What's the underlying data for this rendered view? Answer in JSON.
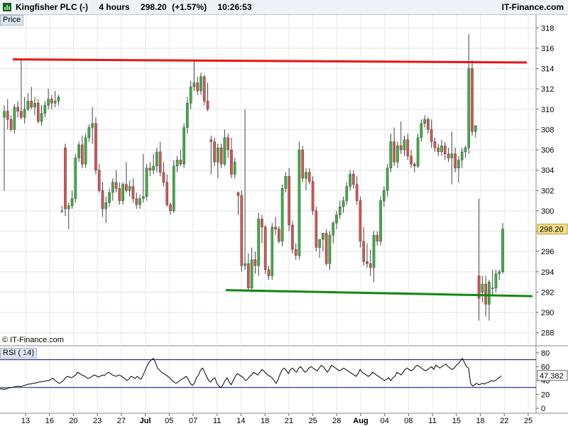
{
  "header": {
    "symbol": "Kingfisher PLC (-)",
    "interval": "4 hours",
    "price": "298.20",
    "change": "(+1.57%)",
    "time": "10:26:53",
    "site": "IT-Finance.com"
  },
  "price_panel_label": "Price",
  "rsi_panel_label": "RSI ( 14)",
  "copyright": "© IT-Finance.com",
  "colors": {
    "up": "#3cb043",
    "down": "#d9534f",
    "resistance": "#ee1111",
    "support": "#118811",
    "rsi": "#000000",
    "rsi_levels": "#000088"
  },
  "chart_data": [
    {
      "type": "candlestick",
      "title": "Price",
      "ylim": [
        287,
        319
      ],
      "y_ticks": [
        "318",
        "316",
        "314",
        "312",
        "310",
        "308",
        "306",
        "304",
        "302",
        "300",
        "298",
        "296",
        "294",
        "292",
        "290",
        "288"
      ],
      "last_price_label": "298.20",
      "x_ticks": [
        "13",
        "16",
        "20",
        "23",
        "27",
        "Jul",
        "05",
        "07",
        "11",
        "14",
        "18",
        "21",
        "25",
        "28",
        "Aug",
        "04",
        "08",
        "11",
        "15",
        "18",
        "22",
        "25"
      ],
      "candles": [
        [
          309.2,
          310.4,
          302.0,
          309.8
        ],
        [
          309.8,
          311.0,
          308.0,
          309.0
        ],
        [
          309.0,
          309.4,
          307.8,
          308.0
        ],
        [
          308.0,
          310.5,
          307.6,
          310.2
        ],
        [
          310.2,
          310.8,
          309.2,
          309.8
        ],
        [
          309.8,
          314.8,
          309.0,
          309.2
        ],
        [
          309.2,
          311.2,
          308.6,
          310.0
        ],
        [
          310.0,
          311.6,
          309.8,
          310.8
        ],
        [
          310.8,
          312.2,
          310.0,
          310.2
        ],
        [
          310.2,
          311.2,
          309.4,
          310.6
        ],
        [
          310.6,
          311.0,
          308.6,
          308.8
        ],
        [
          308.8,
          310.4,
          308.4,
          309.6
        ],
        [
          309.6,
          310.8,
          309.2,
          310.4
        ],
        [
          310.4,
          312.0,
          310.0,
          311.0
        ],
        [
          311.0,
          311.4,
          310.0,
          310.6
        ],
        [
          310.6,
          311.8,
          310.2,
          310.8
        ],
        [
          310.8,
          311.4,
          310.4,
          311.2
        ],
        [
          300.0,
          300.5,
          299.8,
          300.0
        ],
        [
          306.2,
          306.6,
          299.5,
          300.2
        ],
        [
          300.2,
          300.8,
          298.2,
          300.5
        ],
        [
          300.5,
          302.0,
          300.2,
          301.2
        ],
        [
          301.2,
          305.6,
          300.8,
          305.2
        ],
        [
          305.2,
          306.8,
          304.8,
          306.5
        ],
        [
          306.5,
          307.4,
          304.2,
          304.6
        ],
        [
          304.6,
          307.6,
          304.2,
          307.2
        ],
        [
          307.2,
          308.5,
          306.8,
          308.2
        ],
        [
          308.2,
          310.2,
          306.6,
          308.6
        ],
        [
          308.6,
          309.2,
          303.6,
          304.0
        ],
        [
          304.0,
          304.6,
          301.8,
          302.0
        ],
        [
          302.0,
          302.8,
          299.4,
          300.2
        ],
        [
          300.2,
          301.4,
          298.8,
          300.8
        ],
        [
          300.8,
          302.2,
          300.4,
          301.8
        ],
        [
          301.8,
          303.2,
          301.0,
          302.8
        ],
        [
          302.8,
          304.0,
          301.8,
          302.2
        ],
        [
          302.2,
          302.8,
          300.6,
          301.0
        ],
        [
          301.0,
          302.8,
          300.6,
          302.6
        ],
        [
          302.6,
          304.8,
          301.8,
          302.0
        ],
        [
          302.0,
          303.0,
          301.4,
          302.4
        ],
        [
          302.4,
          303.2,
          300.8,
          301.2
        ],
        [
          301.2,
          301.8,
          300.2,
          300.6
        ],
        [
          300.6,
          301.6,
          300.2,
          301.2
        ],
        [
          301.2,
          305.6,
          300.8,
          301.4
        ],
        [
          301.4,
          304.6,
          301.0,
          304.2
        ],
        [
          304.2,
          304.8,
          303.4,
          304.0
        ],
        [
          304.0,
          305.6,
          303.6,
          304.4
        ],
        [
          304.4,
          306.2,
          303.8,
          305.8
        ],
        [
          305.8,
          306.8,
          303.4,
          303.8
        ],
        [
          303.8,
          304.8,
          302.4,
          302.8
        ],
        [
          302.8,
          303.6,
          300.4,
          300.6
        ],
        [
          300.6,
          300.8,
          299.6,
          300.0
        ],
        [
          300.0,
          305.0,
          299.8,
          304.4
        ],
        [
          304.4,
          305.4,
          303.8,
          305.0
        ],
        [
          305.0,
          306.0,
          304.4,
          304.6
        ],
        [
          304.6,
          308.6,
          304.2,
          308.2
        ],
        [
          308.2,
          311.2,
          307.6,
          310.6
        ],
        [
          310.6,
          312.8,
          310.0,
          312.2
        ],
        [
          312.2,
          314.8,
          311.8,
          312.6
        ],
        [
          312.6,
          313.2,
          311.4,
          311.8
        ],
        [
          311.8,
          313.6,
          311.4,
          313.2
        ],
        [
          313.2,
          313.4,
          310.4,
          310.8
        ],
        [
          310.8,
          312.6,
          309.8,
          310.0
        ],
        [
          307.0,
          307.4,
          303.6,
          306.8
        ],
        [
          306.8,
          307.2,
          304.4,
          304.8
        ],
        [
          304.8,
          306.6,
          303.2,
          306.2
        ],
        [
          306.2,
          306.6,
          304.2,
          304.6
        ],
        [
          304.6,
          308.0,
          304.4,
          307.2
        ],
        [
          307.2,
          307.6,
          305.2,
          306.0
        ],
        [
          306.0,
          307.2,
          303.2,
          303.6
        ],
        [
          303.6,
          305.2,
          303.2,
          304.8
        ],
        [
          301.8,
          301.9,
          299.6,
          301.5
        ],
        [
          301.5,
          302.0,
          294.0,
          294.6
        ],
        [
          294.6,
          310.0,
          294.2,
          294.8
        ],
        [
          294.8,
          295.8,
          292.2,
          292.4
        ],
        [
          292.4,
          296.4,
          292.0,
          295.2
        ],
        [
          295.2,
          296.0,
          293.8,
          294.6
        ],
        [
          294.6,
          299.8,
          293.6,
          299.2
        ],
        [
          299.2,
          299.6,
          296.8,
          298.4
        ],
        [
          298.4,
          298.6,
          293.8,
          294.2
        ],
        [
          294.2,
          294.6,
          293.2,
          293.6
        ],
        [
          293.6,
          298.8,
          293.2,
          298.4
        ],
        [
          298.4,
          299.4,
          297.6,
          298.2
        ],
        [
          298.2,
          298.5,
          296.8,
          297.0
        ],
        [
          297.0,
          302.6,
          296.5,
          302.2
        ],
        [
          302.2,
          303.8,
          301.8,
          303.4
        ],
        [
          303.4,
          304.2,
          298.0,
          298.6
        ],
        [
          298.6,
          299.0,
          295.8,
          296.2
        ],
        [
          296.2,
          296.8,
          295.2,
          295.6
        ],
        [
          295.6,
          306.8,
          295.2,
          306.0
        ],
        [
          306.0,
          306.4,
          302.8,
          303.2
        ],
        [
          303.2,
          304.2,
          302.0,
          303.8
        ],
        [
          303.8,
          304.2,
          302.6,
          302.9
        ],
        [
          302.9,
          303.4,
          299.6,
          300.0
        ],
        [
          300.0,
          300.4,
          296.0,
          296.4
        ],
        [
          296.4,
          296.8,
          295.4,
          297.2
        ],
        [
          297.2,
          297.6,
          296.0,
          297.8
        ],
        [
          297.8,
          298.2,
          294.6,
          294.8
        ],
        [
          294.8,
          298.0,
          294.2,
          297.6
        ],
        [
          297.6,
          299.0,
          296.8,
          298.8
        ],
        [
          298.8,
          300.0,
          298.2,
          299.6
        ],
        [
          299.6,
          301.0,
          299.2,
          300.4
        ],
        [
          300.4,
          301.4,
          299.8,
          301.0
        ],
        [
          301.0,
          302.8,
          300.6,
          302.4
        ],
        [
          302.4,
          304.0,
          302.0,
          303.6
        ],
        [
          303.6,
          304.0,
          302.2,
          302.6
        ],
        [
          302.6,
          303.4,
          300.6,
          301.0
        ],
        [
          301.0,
          301.4,
          296.4,
          297.0
        ],
        [
          297.0,
          298.4,
          294.6,
          295.0
        ],
        [
          295.0,
          296.8,
          294.4,
          294.8
        ],
        [
          294.8,
          296.2,
          293.6,
          294.4
        ],
        [
          294.4,
          298.0,
          293.0,
          297.6
        ],
        [
          297.6,
          298.0,
          296.6,
          297.0
        ],
        [
          297.0,
          301.4,
          296.6,
          301.0
        ],
        [
          301.0,
          302.4,
          300.4,
          302.0
        ],
        [
          302.0,
          304.6,
          301.4,
          304.2
        ],
        [
          304.2,
          307.6,
          303.8,
          306.8
        ],
        [
          306.8,
          308.2,
          304.4,
          304.8
        ],
        [
          304.8,
          306.8,
          304.2,
          306.4
        ],
        [
          306.4,
          308.8,
          305.6,
          306.0
        ],
        [
          306.0,
          307.4,
          305.4,
          307.0
        ],
        [
          307.0,
          307.6,
          305.0,
          305.4
        ],
        [
          305.4,
          306.0,
          304.2,
          304.6
        ],
        [
          304.6,
          304.8,
          303.8,
          304.4
        ],
        [
          304.4,
          307.6,
          304.2,
          307.2
        ],
        [
          307.2,
          309.0,
          306.8,
          308.6
        ],
        [
          308.6,
          309.4,
          308.2,
          309.0
        ],
        [
          309.0,
          309.2,
          307.6,
          308.0
        ],
        [
          308.0,
          309.0,
          306.2,
          306.8
        ],
        [
          306.8,
          307.2,
          305.8,
          306.2
        ],
        [
          306.2,
          306.6,
          305.4,
          305.8
        ],
        [
          305.8,
          307.0,
          305.4,
          306.4
        ],
        [
          306.4,
          306.8,
          305.0,
          305.6
        ],
        [
          305.6,
          306.2,
          304.8,
          305.2
        ],
        [
          305.2,
          307.8,
          302.6,
          305.6
        ],
        [
          305.6,
          306.2,
          303.8,
          304.2
        ],
        [
          304.2,
          305.4,
          302.8,
          305.0
        ],
        [
          305.0,
          306.2,
          304.2,
          305.8
        ],
        [
          305.8,
          306.4,
          305.2,
          306.2
        ],
        [
          306.2,
          317.4,
          305.6,
          314.0
        ],
        [
          314.0,
          314.8,
          307.4,
          307.8
        ],
        [
          307.8,
          308.2,
          307.2,
          308.4
        ],
        [
          293.6,
          301.2,
          289.2,
          291.4
        ],
        [
          292.0,
          293.6,
          291.0,
          292.8
        ],
        [
          292.8,
          293.6,
          289.6,
          290.8
        ],
        [
          290.8,
          293.2,
          289.2,
          293.0
        ],
        [
          292.4,
          294.2,
          291.6,
          292.4
        ],
        [
          292.4,
          294.2,
          292.0,
          293.8
        ],
        [
          293.8,
          294.2,
          293.2,
          294.0
        ],
        [
          294.0,
          298.8,
          293.8,
          298.2
        ]
      ],
      "resistance": {
        "from": [
          316.0,
          314.9
        ],
        "to": [
          316.4,
          314.6
        ]
      },
      "support": {
        "from": [
          292.0,
          292.2
        ],
        "to": [
          292.4,
          291.6
        ]
      }
    },
    {
      "type": "line",
      "title": "RSI ( 14)",
      "ylim": [
        -5,
        85
      ],
      "y_ticks": [
        "80",
        "60",
        "40",
        "20",
        "0"
      ],
      "levels": [
        70,
        30
      ],
      "last_value_label": "47.382",
      "values": [
        28,
        28,
        27,
        28,
        29,
        30,
        30,
        31,
        31,
        32,
        31,
        32,
        33,
        34,
        35,
        35,
        36,
        36,
        37,
        38,
        38,
        39,
        39,
        40,
        40,
        42,
        43,
        40,
        38,
        36,
        38,
        40,
        44,
        46,
        45,
        44,
        46,
        48,
        52,
        50,
        48,
        47,
        45,
        43,
        44,
        46,
        48,
        47,
        45,
        46,
        48,
        47,
        50,
        52,
        50,
        48,
        47,
        46,
        48,
        47,
        45,
        43,
        40,
        42,
        46,
        45,
        43,
        46,
        44,
        42,
        48,
        55,
        62,
        67,
        70,
        72,
        66,
        58,
        55,
        52,
        50,
        48,
        46,
        44,
        40,
        38,
        36,
        38,
        40,
        42,
        44,
        46,
        42,
        36,
        33,
        36,
        44,
        48,
        55,
        58,
        52,
        46,
        40,
        38,
        42,
        44,
        36,
        32,
        30,
        34,
        40,
        44,
        38,
        34,
        40,
        46,
        50,
        48,
        46,
        44,
        40,
        42,
        46,
        48,
        52,
        50,
        48,
        52,
        56,
        54,
        50,
        48,
        46,
        44,
        40,
        36,
        42,
        50,
        56,
        58,
        54,
        50,
        56,
        58,
        54,
        52,
        58,
        60,
        56,
        52,
        54,
        58,
        60,
        58,
        56,
        54,
        58,
        62,
        60,
        56,
        52,
        56,
        62,
        60,
        58,
        56,
        54,
        56,
        58,
        56,
        54,
        52,
        50,
        48,
        46,
        50,
        56,
        52,
        50,
        48,
        46,
        48,
        52,
        50,
        48,
        46,
        44,
        42,
        40,
        42,
        44,
        40,
        44,
        46,
        52,
        50,
        48,
        52,
        56,
        58,
        56,
        54,
        56,
        60,
        62,
        60,
        58,
        56,
        54,
        56,
        58,
        60,
        56,
        62,
        60,
        58,
        60,
        62,
        64,
        60,
        58,
        56,
        58,
        62,
        64,
        68,
        72,
        66,
        60,
        58,
        36,
        32,
        34,
        36,
        34,
        35,
        36,
        35,
        37,
        38,
        40,
        39,
        40,
        42,
        44,
        47
      ]
    }
  ]
}
